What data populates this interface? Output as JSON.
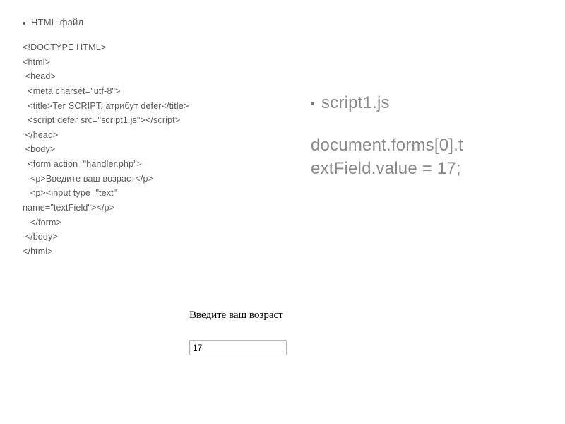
{
  "left": {
    "bullet_label": "HTML-файл",
    "code_lines": [
      "<!DOCTYPE HTML>",
      "<html>",
      " <head>",
      "  <meta charset=\"utf-8\">",
      "  <title>Тег SCRIPT, атрибут defer</title>",
      "  <script defer src=\"script1.js\"></script>",
      " </head>",
      " <body>",
      "  <form action=\"handler.php\">",
      "   <p>Введите ваш возраст</p>",
      "   <p><input type=\"text\"",
      "name=\"textField\"></p>",
      "   </form>",
      " </body>",
      "</html>"
    ]
  },
  "right": {
    "bullet_label": "script1.js",
    "code_line1": "document.forms[0].t",
    "code_line2": "extField.value = 17;"
  },
  "render": {
    "label": "Введите ваш возраст",
    "input_value": "17"
  }
}
